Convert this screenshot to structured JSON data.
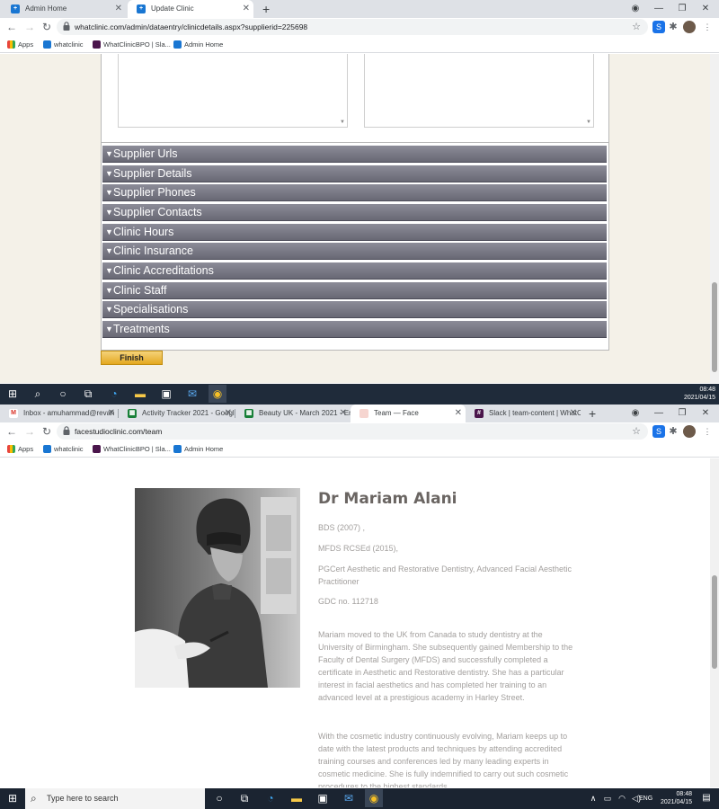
{
  "window1": {
    "tabs": [
      {
        "label": "Admin Home",
        "active": false
      },
      {
        "label": "Update Clinic",
        "active": true
      }
    ],
    "url": "whatclinic.com/admin/dataentry/clinicdetails.aspx?supplierid=225698",
    "bookmarks": [
      "Apps",
      "whatclinic",
      "WhatClinicBPO | Sla...",
      "Admin Home"
    ],
    "sections": [
      "Supplier Urls",
      "Supplier Details",
      "Supplier Phones",
      "Supplier Contacts",
      "Clinic Hours",
      "Clinic Insurance",
      "Clinic Accreditations",
      "Clinic Staff",
      "Specialisations",
      "Treatments"
    ],
    "finish_label": "Finish"
  },
  "taskbar1": {
    "time": "08:48",
    "date": "2021/04/15"
  },
  "window2": {
    "tabs": [
      {
        "label": "Inbox - amuhammad@revah",
        "active": false
      },
      {
        "label": "Activity Tracker 2021 - Googl",
        "active": false
      },
      {
        "label": "Beauty UK - March 2021 - En",
        "active": false
      },
      {
        "label": "Team — Face",
        "active": true
      },
      {
        "label": "Slack | team-content | WhatC",
        "active": false
      }
    ],
    "url": "facestudioclinic.com/team",
    "bookmarks": [
      "Apps",
      "whatclinic",
      "WhatClinicBPO | Sla...",
      "Admin Home"
    ]
  },
  "profile": {
    "name": "Dr Mariam Alani",
    "qual1": "BDS (2007) ,",
    "qual2": "MFDS RCSEd (2015),",
    "qual3": "PGCert Aesthetic and Restorative Dentistry, Advanced Facial Aesthetic Practitioner",
    "gdc": "GDC no. 112718",
    "bio1": "Mariam moved to the UK from Canada to study dentistry at the University of Birmingham. She subsequently gained Membership to the Faculty of Dental Surgery (MFDS) and successfully completed a certificate in Aesthetic and Restorative dentistry.  She has a particular interest in facial aesthetics and has completed her training to an advanced level at a prestigious academy in Harley Street.",
    "bio2": "With the cosmetic industry continuously evolving, Mariam keeps up to date with the latest products and techniques by attending accredited training courses and conferences led by many  leading experts in cosmetic medicine. She is fully indemnified to carry out such cosmetic procedures to the highest standards."
  },
  "taskbar2": {
    "search_placeholder": "Type here to search",
    "lang": "ENG",
    "time": "08:48",
    "date": "2021/04/15"
  }
}
